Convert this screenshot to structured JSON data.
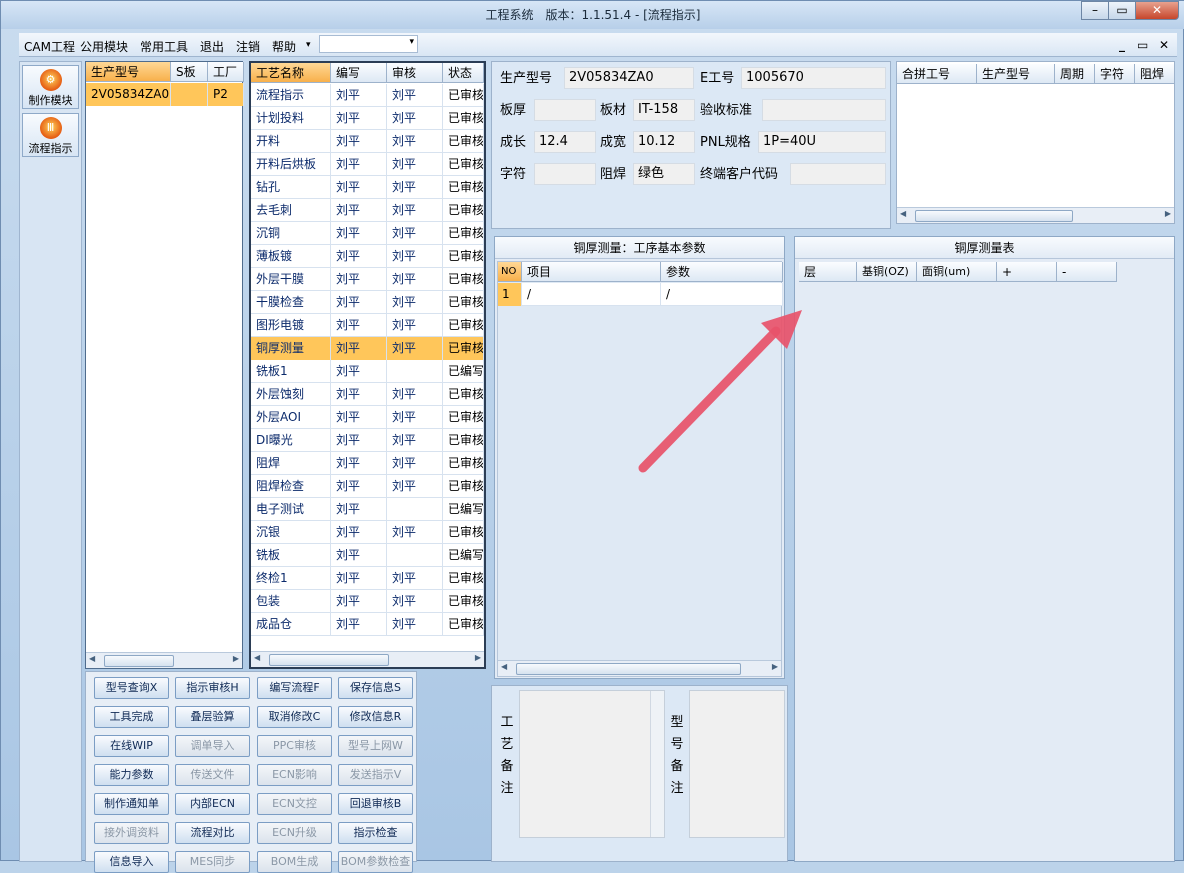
{
  "title": "工程系统　版本：1.1.51.4 - [流程指示]",
  "window_buttons": {
    "minimize": "–",
    "restore": "▭",
    "close": "✕"
  },
  "menu": [
    "CAM工程",
    "公用模块",
    "常用工具",
    "退出",
    "注销",
    "帮助"
  ],
  "menu_more": "▾",
  "mdi_buttons": {
    "min": "_",
    "restore": "▭",
    "close": "✕"
  },
  "nav": [
    {
      "label": "制作模块",
      "icon": "⚙"
    },
    {
      "label": "流程指示",
      "icon": "Ⅲ"
    }
  ],
  "parts": {
    "headers": [
      "生产型号",
      "S板",
      "工厂"
    ],
    "rows": [
      [
        "2V05834ZA0",
        "",
        "P2"
      ]
    ]
  },
  "process": {
    "headers": [
      "工艺名称",
      "编写",
      "审核",
      "状态"
    ],
    "rows": [
      [
        "流程指示",
        "刘平",
        "刘平",
        "已审核"
      ],
      [
        "计划投料",
        "刘平",
        "刘平",
        "已审核"
      ],
      [
        "开料",
        "刘平",
        "刘平",
        "已审核"
      ],
      [
        "开料后烘板",
        "刘平",
        "刘平",
        "已审核"
      ],
      [
        "钻孔",
        "刘平",
        "刘平",
        "已审核"
      ],
      [
        "去毛刺",
        "刘平",
        "刘平",
        "已审核"
      ],
      [
        "沉铜",
        "刘平",
        "刘平",
        "已审核"
      ],
      [
        "薄板镀",
        "刘平",
        "刘平",
        "已审核"
      ],
      [
        "外层干膜",
        "刘平",
        "刘平",
        "已审核"
      ],
      [
        "干膜检查",
        "刘平",
        "刘平",
        "已审核"
      ],
      [
        "图形电镀",
        "刘平",
        "刘平",
        "已审核"
      ],
      [
        "铜厚测量",
        "刘平",
        "刘平",
        "已审核"
      ],
      [
        "铣板1",
        "刘平",
        "",
        "已编写"
      ],
      [
        "外层蚀刻",
        "刘平",
        "刘平",
        "已审核"
      ],
      [
        "外层AOI",
        "刘平",
        "刘平",
        "已审核"
      ],
      [
        "DI曝光",
        "刘平",
        "刘平",
        "已审核"
      ],
      [
        "阻焊",
        "刘平",
        "刘平",
        "已审核"
      ],
      [
        "阻焊检查",
        "刘平",
        "刘平",
        "已审核"
      ],
      [
        "电子测试",
        "刘平",
        "",
        "已编写"
      ],
      [
        "沉银",
        "刘平",
        "刘平",
        "已审核"
      ],
      [
        "铣板",
        "刘平",
        "",
        "已编写"
      ],
      [
        "终检1",
        "刘平",
        "刘平",
        "已审核"
      ],
      [
        "包装",
        "刘平",
        "刘平",
        "已审核"
      ],
      [
        "成品仓",
        "刘平",
        "刘平",
        "已审核"
      ]
    ],
    "selected": 11
  },
  "buttons": [
    [
      "型号查询X",
      "指示审核H",
      "编写流程F",
      "保存信息S"
    ],
    [
      "工具完成",
      "叠层验算",
      "取消修改C",
      "修改信息R"
    ],
    [
      "在线WIP",
      "调单导入",
      "PPC审核",
      "型号上网W"
    ],
    [
      "能力参数",
      "传送文件",
      "ECN影响",
      "发送指示V"
    ],
    [
      "制作通知单",
      "内部ECN",
      "ECN文控",
      "回退审核B"
    ],
    [
      "接外调资料",
      "流程对比",
      "ECN升级",
      "指示检查"
    ],
    [
      "信息导入",
      "MES同步",
      "BOM生成",
      "BOM参数检查"
    ]
  ],
  "disabled_buttons": [
    "调单导入",
    "PPC审核",
    "型号上网W",
    "传送文件",
    "ECN影响",
    "发送指示V",
    "ECN文控",
    "接外调资料",
    "ECN升级",
    "MES同步",
    "BOM生成",
    "BOM参数检查"
  ],
  "info": {
    "生产型号": "2V05834ZA0",
    "E工号": "1005670",
    "板厚": "",
    "板材": "IT-158",
    "验收标准": "",
    "成长": "12.4",
    "成宽": "10.12",
    "PNL规格": "1P=40U",
    "字符": "",
    "阻焊": "绿色",
    "终端客户代码": ""
  },
  "merge": {
    "headers": [
      "合拼工号",
      "生产型号",
      "周期",
      "字符",
      "阻焊"
    ]
  },
  "params": {
    "title": "铜厚测量：工序基本参数",
    "headers": [
      "NO",
      "项目",
      "参数"
    ],
    "rows": [
      [
        "1",
        "/",
        "/"
      ]
    ]
  },
  "measure": {
    "title": "铜厚测量表",
    "headers": [
      "层",
      "基铜(OZ)",
      "面铜(um)",
      "+",
      "-"
    ]
  },
  "remarks": {
    "process": "工艺备注",
    "model": "型号备注"
  }
}
